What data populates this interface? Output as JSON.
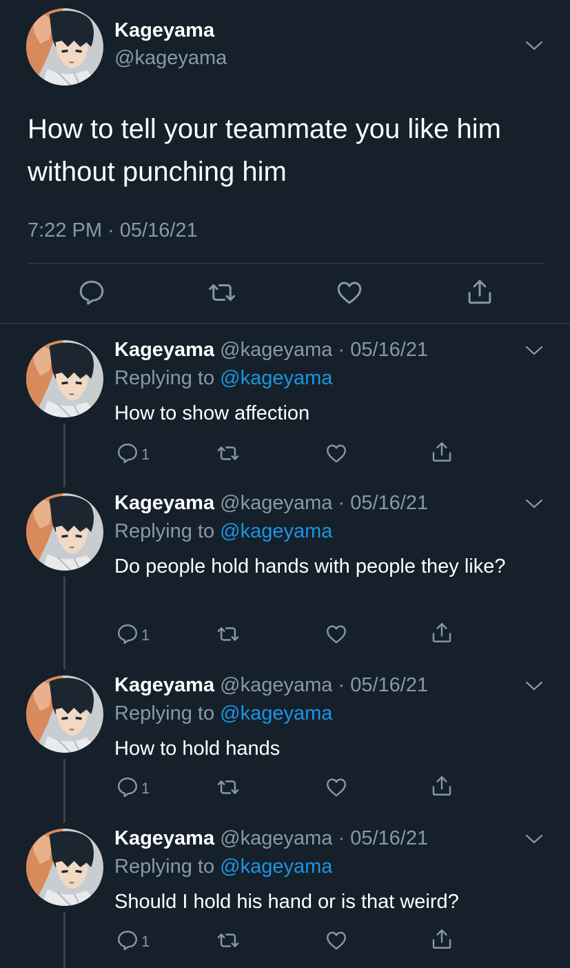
{
  "main_tweet": {
    "author_name": "Kageyama",
    "author_handle": "@kageyama",
    "text": "How to tell your teammate you like him without punching him",
    "timestamp": "7:22 PM · 05/16/21",
    "avatar_icon": "avatar-kageyama",
    "actions": [
      "reply-icon",
      "retweet-icon",
      "like-icon",
      "share-icon"
    ]
  },
  "replies": [
    {
      "author_name": "Kageyama",
      "author_handle": "@kageyama",
      "separator": "·",
      "date": "05/16/21",
      "replying_to_label": "Replying to",
      "replying_to_handle": "@kageyama",
      "text": "How to show affection",
      "reply_count": "1"
    },
    {
      "author_name": "Kageyama",
      "author_handle": "@kageyama",
      "separator": "·",
      "date": "05/16/21",
      "replying_to_label": "Replying to",
      "replying_to_handle": "@kageyama",
      "text": "Do people hold hands with people they like?",
      "reply_count": "1"
    },
    {
      "author_name": "Kageyama",
      "author_handle": "@kageyama",
      "separator": "·",
      "date": "05/16/21",
      "replying_to_label": "Replying to",
      "replying_to_handle": "@kageyama",
      "text": "How to hold hands",
      "reply_count": "1"
    },
    {
      "author_name": "Kageyama",
      "author_handle": "@kageyama",
      "separator": "·",
      "date": "05/16/21",
      "replying_to_label": "Replying to",
      "replying_to_handle": "@kageyama",
      "text": "Should I hold his hand or is that weird?",
      "reply_count": "1"
    }
  ],
  "colors": {
    "background": "#15202b",
    "secondary_text": "#8899a6",
    "link": "#1b95e0",
    "divider": "#38444d"
  }
}
